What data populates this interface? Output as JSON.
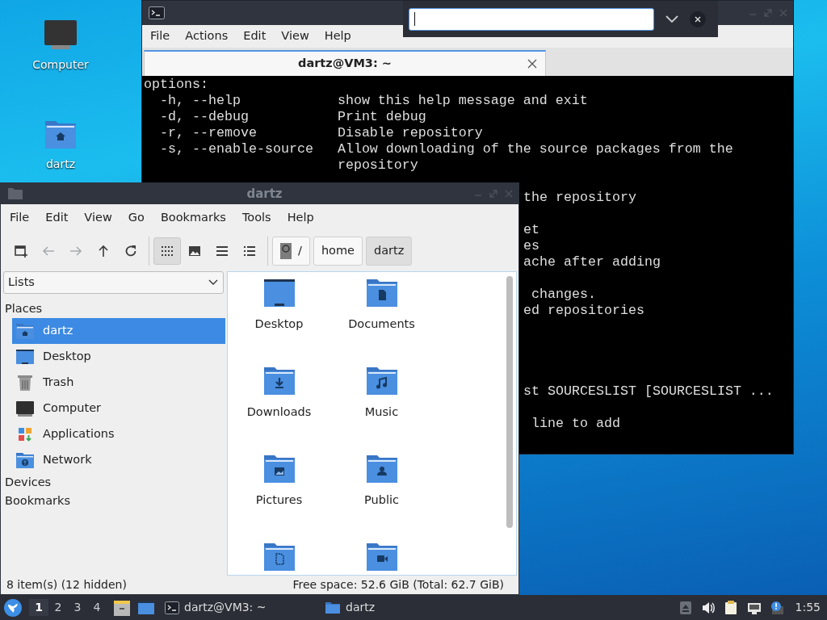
{
  "desktop_icons": [
    {
      "label": "Computer",
      "kind": "computer"
    },
    {
      "label": "dartz",
      "kind": "home"
    }
  ],
  "terminal": {
    "menu": [
      "File",
      "Actions",
      "Edit",
      "View",
      "Help"
    ],
    "tab": {
      "label": "dartz@VM3: ~",
      "selected": true
    },
    "search_bar": {
      "open": true
    },
    "lines": [
      {
        "kind": "full",
        "text": "options:"
      },
      {
        "kind": "full",
        "text": "  -h, --help            show this help message and exit"
      },
      {
        "kind": "full",
        "text": "  -d, --debug           Print debug"
      },
      {
        "kind": "full",
        "text": "  -r, --remove          Disable repository"
      },
      {
        "kind": "full",
        "text": "  -s, --enable-source   Allow downloading of the source packages from the"
      },
      {
        "kind": "full",
        "text": "                        repository"
      },
      {
        "kind": "blank"
      },
      {
        "kind": "tail",
        "text": "the repository"
      },
      {
        "kind": "blank"
      },
      {
        "kind": "tail",
        "text": "et"
      },
      {
        "kind": "tail",
        "text": "es"
      },
      {
        "kind": "tail",
        "text": "ache after adding"
      },
      {
        "kind": "blank"
      },
      {
        "kind": "tail",
        "text": " changes."
      },
      {
        "kind": "tail",
        "text": "ed repositories"
      },
      {
        "kind": "blank"
      },
      {
        "kind": "blank"
      },
      {
        "kind": "blank"
      },
      {
        "kind": "blank"
      },
      {
        "kind": "tail",
        "text": "st SOURCESLIST [SOURCESLIST ..."
      },
      {
        "kind": "blank"
      },
      {
        "kind": "tail",
        "text": " line to add"
      }
    ]
  },
  "file_manager": {
    "title": "dartz",
    "menu": [
      "File",
      "Edit",
      "View",
      "Go",
      "Bookmarks",
      "Tools",
      "Help"
    ],
    "toolbar": [
      {
        "kind": "new-tab",
        "disabled": false
      },
      {
        "kind": "back",
        "disabled": true
      },
      {
        "kind": "forward",
        "disabled": true
      },
      {
        "kind": "up",
        "disabled": false
      },
      {
        "kind": "reload",
        "disabled": false
      },
      {
        "kind": "separator"
      },
      {
        "kind": "icon-view",
        "selected": true
      },
      {
        "kind": "thumbnail-view",
        "selected": false
      },
      {
        "kind": "compact-view",
        "selected": false
      },
      {
        "kind": "detailed-view",
        "selected": false
      },
      {
        "kind": "separator"
      }
    ],
    "path": [
      {
        "kind": "root",
        "label": "/",
        "selected": false
      },
      {
        "kind": "dir",
        "label": "home",
        "selected": false
      },
      {
        "kind": "dir",
        "label": "dartz",
        "selected": true
      }
    ],
    "side_pane_mode": "Lists",
    "sidebar": [
      {
        "kind": "header",
        "label": "Places"
      },
      {
        "kind": "home",
        "label": "dartz",
        "selected": true
      },
      {
        "kind": "desktop",
        "label": "Desktop",
        "selected": false
      },
      {
        "kind": "trash",
        "label": "Trash",
        "selected": false
      },
      {
        "kind": "computer",
        "label": "Computer",
        "selected": false
      },
      {
        "kind": "applications",
        "label": "Applications",
        "selected": false
      },
      {
        "kind": "network",
        "label": "Network",
        "selected": false
      },
      {
        "kind": "header",
        "label": "Devices"
      },
      {
        "kind": "header",
        "label": "Bookmarks"
      }
    ],
    "files": [
      {
        "kind": "desktop",
        "name": "Desktop"
      },
      {
        "kind": "documents",
        "name": "Documents"
      },
      {
        "kind": "downloads",
        "name": "Downloads"
      },
      {
        "kind": "music",
        "name": "Music"
      },
      {
        "kind": "pictures",
        "name": "Pictures"
      },
      {
        "kind": "public",
        "name": "Public"
      },
      {
        "kind": "templates"
      },
      {
        "kind": "videos"
      }
    ],
    "status": {
      "left": "8 item(s) (12 hidden)",
      "right": "Free space: 52.6 GiB (Total: 62.7 GiB)"
    }
  },
  "taskbar": {
    "workspaces": [
      {
        "label": "1",
        "selected": true
      },
      {
        "label": "2",
        "selected": false
      },
      {
        "label": "3",
        "selected": false
      },
      {
        "label": "4",
        "selected": false
      }
    ],
    "launchers": [
      {
        "kind": "file-manager"
      },
      {
        "kind": "show-desktop"
      }
    ],
    "tasks": [
      {
        "kind": "terminal",
        "label": "dartz@VM3: ~"
      },
      {
        "kind": "folder",
        "label": "dartz"
      }
    ],
    "tray": [
      {
        "kind": "eject"
      },
      {
        "kind": "volume"
      },
      {
        "kind": "clipboard"
      },
      {
        "kind": "network"
      },
      {
        "kind": "notification"
      }
    ],
    "clock": "1:55"
  }
}
